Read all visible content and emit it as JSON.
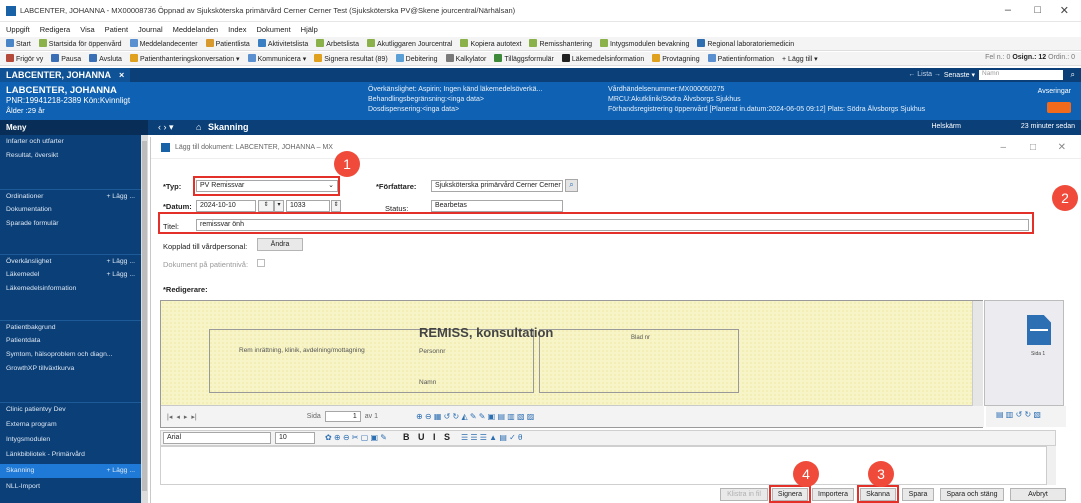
{
  "window": {
    "title": "LABCENTER, JOHANNA - MX00008736 Öppnad av Sjuksköterska primärvård Cerner Cerner Test (Sjuksköterska PV@Skene jourcentral/Närhälsan)",
    "controls": [
      "–",
      "□",
      "✕"
    ]
  },
  "menu": [
    "Uppgift",
    "Redigera",
    "Visa",
    "Patient",
    "Journal",
    "Meddelanden",
    "Index",
    "Dokument",
    "Hjälp"
  ],
  "toolbar1": [
    "Start",
    "Startsida för öppenvård",
    "Meddelandecenter",
    "Patientlista",
    "Aktivitetslista",
    "Arbetslista",
    "Akutliggaren Jourcentral",
    "Kopiera autotext",
    "Remisshantering",
    "Intygsmodulen bevakning",
    "Regional laboratoriemedicin"
  ],
  "toolbar2": [
    "Frigör vy",
    "Pausa",
    "Avsluta",
    "Patienthanteringskonversation ▾",
    "Kommunicera ▾",
    "Signera resultat (89)",
    "Debitering",
    "Kalkylator",
    "Tilläggsformulär",
    "Läkemedelsinformation",
    "Provtagning",
    "Patientinformation",
    "+ Lägg till ▾"
  ],
  "toolbar2_right": {
    "fel": "Fel n.: 0",
    "osign": "Osign.: 12",
    "ordin": "Ordin.: 0"
  },
  "patient_tab": {
    "name": "LABCENTER, JOHANNA",
    "close": "×",
    "lista": "← Lista →",
    "senaste": "Senaste ▾",
    "search_placeholder": "Namn"
  },
  "banner": {
    "name": "LABCENTER, JOHANNA",
    "pnr": "PNR:19941218-2389   Kön:Kvinnligt",
    "age": "Ålder :29 år",
    "allergy": "Överkänslighet: Aspirin; Ingen känd läkemedelsöverkä...",
    "restriction": "Behandlingsbegränsning:<inga data>",
    "dosage": "Dosdispensering:<inga data>",
    "visit": "Vårdhändelsenummer:MX000050275",
    "mrcu": "MRCU:Akutklinik/Södra Älvsborgs Sjukhus",
    "prereg": "Förhandsregistrering öppenvård [Planerat in.datum:2024-06-05 09:12] Plats: Södra Älvsborgs Sjukhus",
    "avs": "Avseringar"
  },
  "sidebar": {
    "header": "Meny",
    "items": [
      {
        "label": "Infarter och utfarter"
      },
      {
        "label": "Resultat, översikt"
      },
      {
        "label": "Ordinationer",
        "add": "+ Lägg ..."
      },
      {
        "label": "Dokumentation"
      },
      {
        "label": "Sparade formulär"
      },
      {
        "label": "Överkänslighet",
        "add": "+ Lägg ..."
      },
      {
        "label": "Läkemedel",
        "add": "+ Lägg ..."
      },
      {
        "label": "Läkemedelsinformation"
      },
      {
        "label": "Patientbakgrund"
      },
      {
        "label": "Patientdata"
      },
      {
        "label": "Symtom, hälsoproblem och diagn..."
      },
      {
        "label": "GrowthXP tillväxtkurva"
      },
      {
        "label": "Clinic patientvy Dev"
      },
      {
        "label": "Externa program"
      },
      {
        "label": "Intygsmodulen"
      },
      {
        "label": "Länkbibliotek - Primärvård"
      },
      {
        "label": "Skanning",
        "add": "+ Lägg ..."
      },
      {
        "label": "NLL-Import"
      }
    ]
  },
  "component": {
    "nav": "‹  ›  ▾",
    "title": "Skanning",
    "fullscreen": "Helskärm",
    "updated": "23 minuter sedan"
  },
  "dialog": {
    "title": "Lägg till dokument: LABCENTER, JOHANNA – MX",
    "typ_label": "*Typ:",
    "typ_value": "PV Remissvar",
    "datum_label": "*Datum:",
    "datum_value": "2024-10-10",
    "time_value": "1033",
    "forfattare_label": "*Författare:",
    "forfattare_value": "Sjuksköterska primärvård Cerner Cerner Te",
    "status_label": "Status:",
    "status_value": "Bearbetas",
    "titel_label": "Titel:",
    "titel_value": "remissvar önh",
    "kopplad_label": "Kopplad till vårdpersonal:",
    "andra_button": "Ändra",
    "patientniva_label": "Dokument på patientnivå:",
    "redigerare_label": "*Redigerare:"
  },
  "scan": {
    "heading": "REMISS, konsultation",
    "blad": "Blad nr",
    "dept": "Rem inrättning, klinik, avdelning/mottagning",
    "personnr": "Personnr",
    "namn": "Namn",
    "thumb_label": "Sida 1"
  },
  "pager": {
    "sida_label": "Sida",
    "page": "1",
    "of": "av 1"
  },
  "format": {
    "font": "Arial",
    "size": "10",
    "buttons": "B U I S"
  },
  "buttons": {
    "klistra": "Klistra in fil",
    "signera": "Signera",
    "importera": "Importera",
    "skanna": "Skanna",
    "spara": "Spara",
    "spara_stang": "Spara och stäng",
    "avbryt": "Avbryt"
  },
  "callouts": [
    "1",
    "2",
    "3",
    "4"
  ],
  "colors": {
    "banner": "#0f62b3",
    "nav": "#0a3f78",
    "callout": "#ef4a3a",
    "document": "#f7f5c8"
  }
}
